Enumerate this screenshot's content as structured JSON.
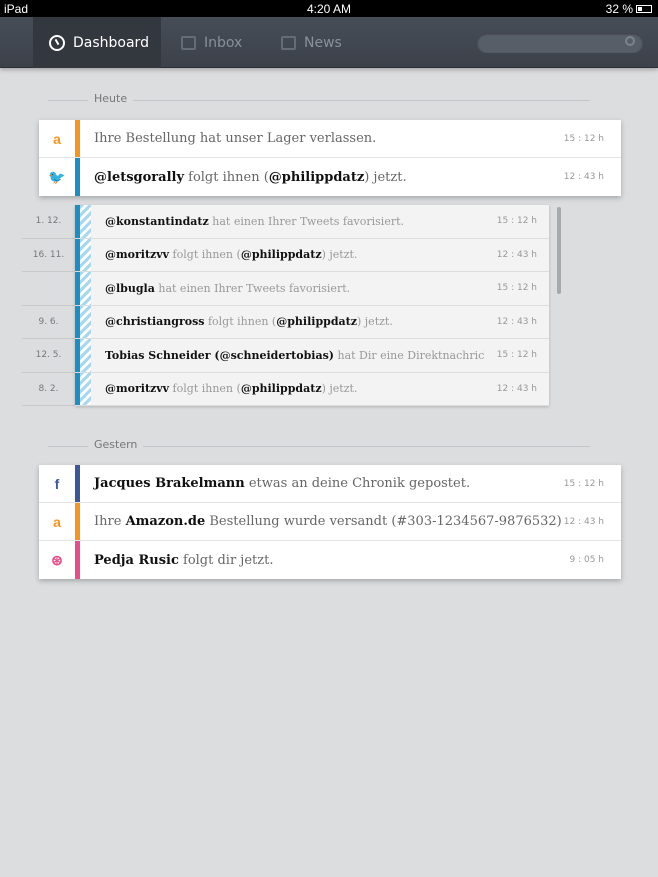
{
  "status_bar": {
    "device": "iPad",
    "time": "4:20 AM",
    "battery": "32 %"
  },
  "nav": {
    "tabs": [
      {
        "label": "Dashboard",
        "icon": "dashboard-icon",
        "active": true
      },
      {
        "label": "Inbox",
        "icon": "inbox-icon"
      },
      {
        "label": "News",
        "icon": "news-icon"
      }
    ],
    "search_placeholder": ""
  },
  "colors": {
    "amazon": "#f7941d",
    "twitter": "#1b8fc4",
    "facebook": "#3b5998",
    "dribbble": "#ea4c89"
  },
  "sections": {
    "today": "Heute",
    "yesterday": "Gestern"
  },
  "today": [
    {
      "icon": "amazon-icon",
      "glyph": "a",
      "color": "#f7941d",
      "segments": [
        {
          "t": "Ihre Bestellung hat unser Lager verlassen."
        }
      ],
      "time": "15 : 12 h"
    },
    {
      "icon": "twitter-icon",
      "glyph": "🐦",
      "color": "#1b8fc4",
      "segments": [
        {
          "t": "@letsgorally",
          "b": true
        },
        {
          "t": " folgt ihnen ("
        },
        {
          "t": "@philippdatz",
          "b": true
        },
        {
          "t": ") jetzt."
        }
      ],
      "time": "12 : 43 h"
    }
  ],
  "twitter_history": [
    {
      "date": "1. 12.",
      "segments": [
        {
          "t": "@konstantindatz",
          "b": true
        },
        {
          "t": " hat einen Ihrer Tweets favorisiert."
        }
      ],
      "time": "15 : 12 h"
    },
    {
      "date": "16. 11.",
      "segments": [
        {
          "t": "@moritzvv",
          "b": true
        },
        {
          "t": " folgt ihnen ("
        },
        {
          "t": "@philippdatz",
          "b": true
        },
        {
          "t": ") jetzt."
        }
      ],
      "time": "12 : 43 h"
    },
    {
      "date": "",
      "segments": [
        {
          "t": "@lbugla",
          "b": true
        },
        {
          "t": " hat einen Ihrer Tweets favorisiert."
        }
      ],
      "time": "15 : 12 h"
    },
    {
      "date": "9. 6.",
      "segments": [
        {
          "t": "@christiangross",
          "b": true
        },
        {
          "t": " folgt ihnen ("
        },
        {
          "t": "@philippdatz",
          "b": true
        },
        {
          "t": ") jetzt."
        }
      ],
      "time": "12 : 43 h"
    },
    {
      "date": "12. 5.",
      "segments": [
        {
          "t": "Tobias Schneider (@schneidertobias)",
          "b": true
        },
        {
          "t": " hat Dir eine Direktnachricht auf"
        }
      ],
      "time": "15 : 12 h"
    },
    {
      "date": "8. 2.",
      "segments": [
        {
          "t": "@moritzvv",
          "b": true
        },
        {
          "t": " folgt ihnen ("
        },
        {
          "t": "@philippdatz",
          "b": true
        },
        {
          "t": ") jetzt."
        }
      ],
      "time": "12 : 43 h"
    }
  ],
  "yesterday": [
    {
      "icon": "facebook-icon",
      "glyph": "f",
      "color": "#3b5998",
      "segments": [
        {
          "t": "Jacques Brakelmann",
          "b": true
        },
        {
          "t": " etwas an deine Chronik gepostet."
        }
      ],
      "time": "15 : 12 h"
    },
    {
      "icon": "amazon-icon",
      "glyph": "a",
      "color": "#f7941d",
      "segments": [
        {
          "t": "Ihre "
        },
        {
          "t": "Amazon.de",
          "b": true
        },
        {
          "t": " Bestellung wurde versandt "
        },
        {
          "t": "(#303-1234567-9876532)"
        }
      ],
      "time": "12 : 43 h"
    },
    {
      "icon": "dribbble-icon",
      "glyph": "⊛",
      "color": "#ea4c89",
      "segments": [
        {
          "t": "Pedja Rusic",
          "b": true
        },
        {
          "t": " folgt dir jetzt."
        }
      ],
      "time": "9 : 05 h"
    }
  ]
}
